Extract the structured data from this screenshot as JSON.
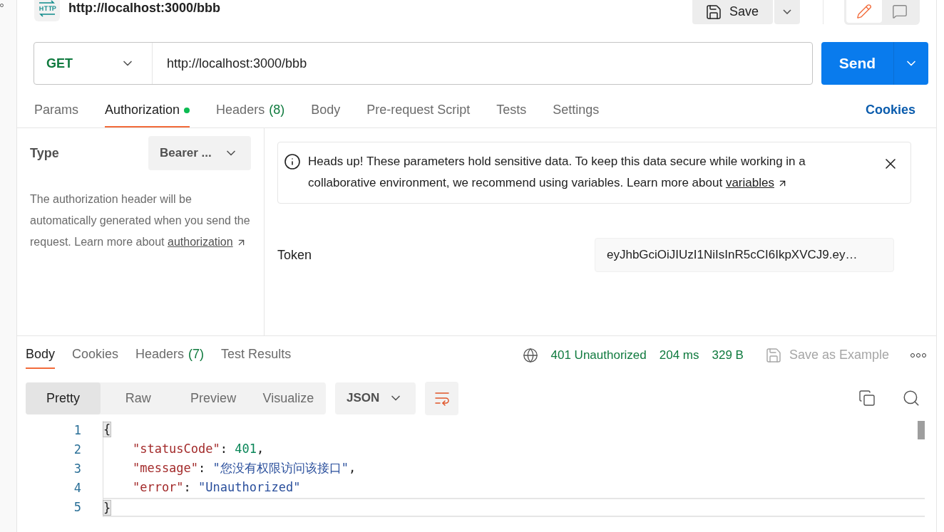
{
  "request": {
    "title": "http://localhost:3000/bbb",
    "save_label": "Save",
    "modes": [
      {
        "kind": "edit",
        "selected": true
      },
      {
        "kind": "comment",
        "selected": false
      }
    ],
    "method": "GET",
    "url": "http://localhost:3000/bbb",
    "send_label": "Send"
  },
  "request_tabs": [
    {
      "label": "Params",
      "selected": false
    },
    {
      "label": "Authorization",
      "dot": true,
      "selected": true
    },
    {
      "label": "Headers",
      "count": "(8)",
      "selected": false
    },
    {
      "label": "Body",
      "selected": false
    },
    {
      "label": "Pre-request Script",
      "selected": false
    },
    {
      "label": "Tests",
      "selected": false
    },
    {
      "label": "Settings",
      "selected": false
    }
  ],
  "cookies_link": "Cookies",
  "auth": {
    "type_label": "Type",
    "type_value": "Bearer ...",
    "description": "The authorization header will be automatically generated when you send the request. Learn more about",
    "link": "authorization"
  },
  "alert": {
    "text": "Heads up! These parameters hold sensitive data. To keep this data secure while working in a collaborative environment, we recommend using variables. Learn more about",
    "link": "variables"
  },
  "token": {
    "label": "Token",
    "value": "eyJhbGciOiJIUzI1NiIsInR5cCI6IkpXVCJ9.ey…"
  },
  "response_tabs": [
    {
      "label": "Body",
      "selected": true
    },
    {
      "label": "Cookies",
      "selected": false
    },
    {
      "label": "Headers",
      "count": "(7)",
      "selected": false
    },
    {
      "label": "Test Results",
      "selected": false
    }
  ],
  "status": {
    "code": "401 Unauthorized",
    "time": "204 ms",
    "size": "329 B",
    "save_example": "Save as Example"
  },
  "view_tabs": [
    {
      "label": "Pretty",
      "selected": true
    },
    {
      "label": "Raw",
      "selected": false
    },
    {
      "label": "Preview",
      "selected": false
    },
    {
      "label": "Visualize",
      "selected": false
    }
  ],
  "format": "JSON",
  "code_lines": [
    {
      "number": "1",
      "active": false,
      "tokens": [
        {
          "kind": "brace",
          "text": "{"
        }
      ]
    },
    {
      "number": "2",
      "active": false,
      "tokens": [
        {
          "kind": "key",
          "text": "    \"statusCode\""
        },
        {
          "kind": "punct",
          "text": ": "
        },
        {
          "kind": "number",
          "text": "401"
        },
        {
          "kind": "punct",
          "text": ","
        }
      ]
    },
    {
      "number": "3",
      "active": false,
      "tokens": [
        {
          "kind": "key",
          "text": "    \"message\""
        },
        {
          "kind": "punct",
          "text": ": "
        },
        {
          "kind": "string",
          "text": "\"您没有权限访问该接口\""
        },
        {
          "kind": "punct",
          "text": ","
        }
      ]
    },
    {
      "number": "4",
      "active": false,
      "tokens": [
        {
          "kind": "key",
          "text": "    \"error\""
        },
        {
          "kind": "punct",
          "text": ": "
        },
        {
          "kind": "string",
          "text": "\"Unauthorized\""
        }
      ]
    },
    {
      "number": "5",
      "active": true,
      "tokens": [
        {
          "kind": "brace",
          "text": "}"
        }
      ]
    }
  ]
}
